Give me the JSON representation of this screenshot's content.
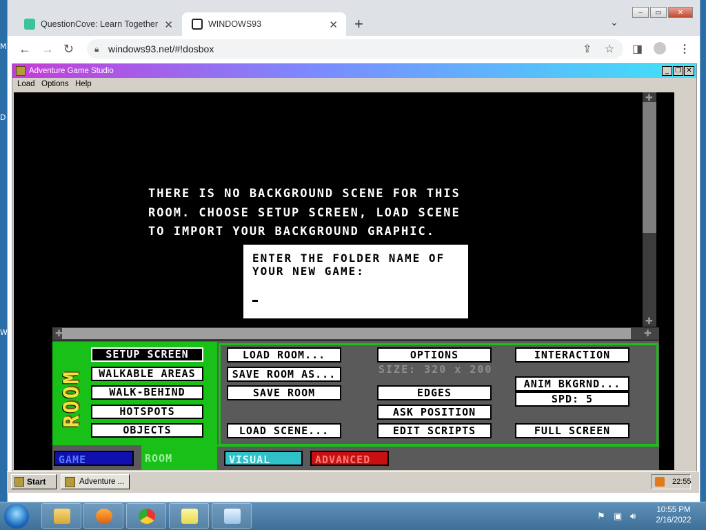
{
  "desktop": {
    "fragments": [
      "M",
      "D",
      "W"
    ]
  },
  "browser": {
    "tabs": [
      {
        "title": "QuestionCove: Learn Together",
        "favicon_color": "#3bc49a",
        "active": false
      },
      {
        "title": "WINDOWS93",
        "favicon_color": "#222222",
        "active": true
      }
    ],
    "new_tab": "+",
    "address": "windows93.net/#!dosbox",
    "window_controls": {
      "minimize": "–",
      "restore": "▭",
      "close": "✕"
    }
  },
  "ags_window": {
    "title": "Adventure Game Studio",
    "menu": [
      "Load",
      "Options",
      "Help"
    ],
    "controls": {
      "minimize": "_",
      "restore": "❐",
      "close": "✕"
    }
  },
  "dos": {
    "message": [
      "THERE IS NO BACKGROUND SCENE FOR THIS",
      "ROOM. CHOOSE SETUP SCREEN, LOAD SCENE",
      "TO IMPORT YOUR BACKGROUND GRAPHIC."
    ],
    "dialog": {
      "prompt_line1": "ENTER THE FOLDER NAME OF",
      "prompt_line2": "YOUR NEW GAME:",
      "cursor": "_"
    },
    "panel": {
      "section_label": "ROOM",
      "left_buttons": [
        "SETUP SCREEN",
        "WALKABLE AREAS",
        "WALK-BEHIND",
        "HOTSPOTS",
        "OBJECTS"
      ],
      "selected": "SETUP SCREEN",
      "col1": [
        "LOAD ROOM...",
        "SAVE ROOM AS...",
        "SAVE ROOM",
        "LOAD SCENE..."
      ],
      "col2": [
        "OPTIONS",
        "EDGES",
        "ASK POSITION",
        "EDIT SCRIPTS"
      ],
      "size_text": "SIZE: 320 x 200",
      "col3": [
        "INTERACTION",
        "ANIM BKGRND...",
        "SPD: 5",
        "FULL SCREEN"
      ],
      "mode_tabs": [
        {
          "label": "GAME",
          "bg": "#1010b0",
          "fg": "#5a7aff"
        },
        {
          "label": "ROOM",
          "bg": "#18c018",
          "fg": "#9cf09c"
        },
        {
          "label": "VISUAL",
          "bg": "#30c0c8",
          "fg": "#d8ffff"
        },
        {
          "label": "ADVANCED",
          "bg": "#c81010",
          "fg": "#ff7a7a"
        }
      ]
    }
  },
  "win93_taskbar": {
    "start": "Start",
    "item": "Adventure ...",
    "time": "22:55"
  },
  "win7_taskbar": {
    "time": "10:55 PM",
    "date": "2/16/2022"
  }
}
